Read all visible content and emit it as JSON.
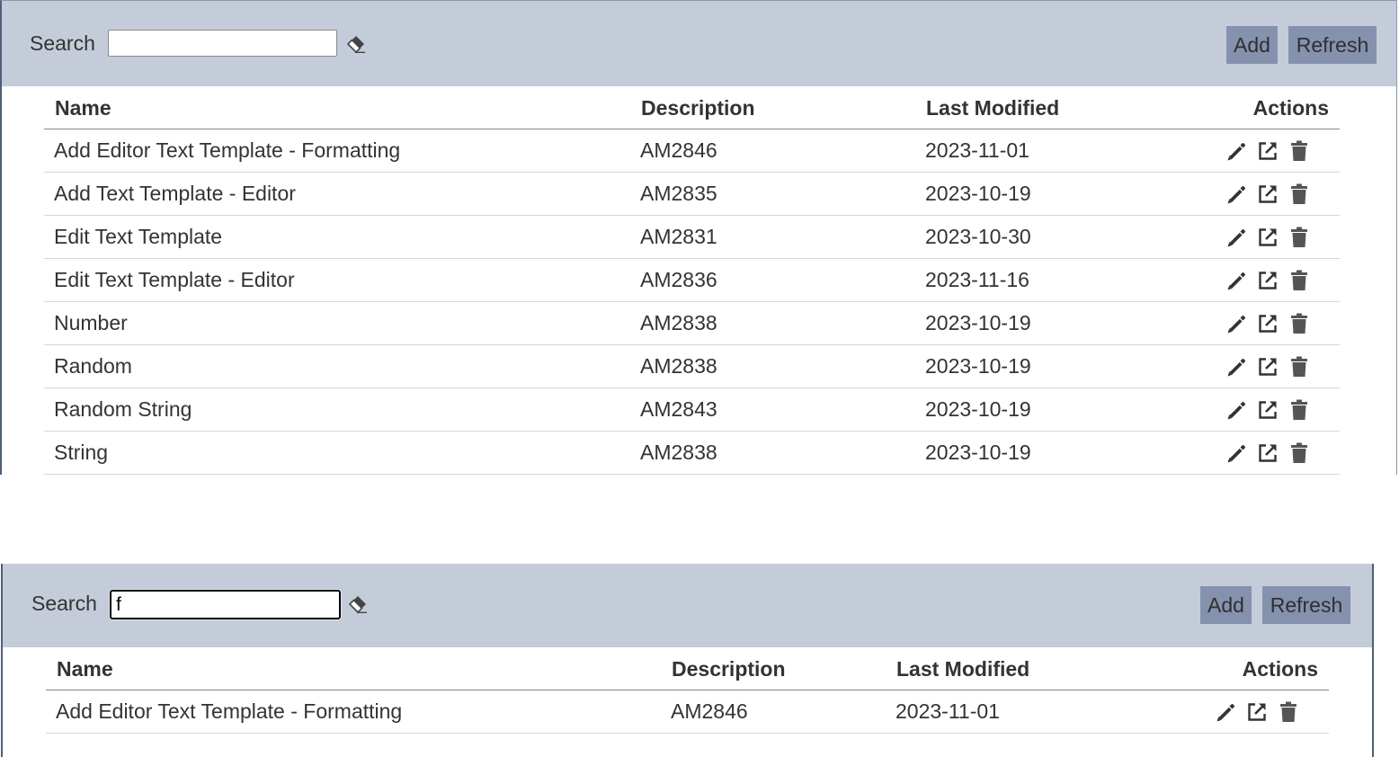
{
  "colors": {
    "toolbar_bg": "#c5ccd9",
    "button_bg": "#8592ae",
    "panel_border": "#4f5f77"
  },
  "icons": {
    "clear": "eraser-icon",
    "edit": "pencil-icon",
    "open": "external-link-icon",
    "delete": "trash-icon"
  },
  "panels": [
    {
      "search": {
        "label": "Search",
        "value": ""
      },
      "buttons": {
        "add": "Add",
        "refresh": "Refresh"
      },
      "columns": {
        "name": "Name",
        "description": "Description",
        "modified": "Last Modified",
        "actions": "Actions"
      },
      "rows": [
        {
          "name": "Add Editor Text Template - Formatting",
          "description": "AM2846",
          "modified": "2023-11-01"
        },
        {
          "name": "Add Text Template - Editor",
          "description": "AM2835",
          "modified": "2023-10-19"
        },
        {
          "name": "Edit Text Template",
          "description": "AM2831",
          "modified": "2023-10-30"
        },
        {
          "name": "Edit Text Template - Editor",
          "description": "AM2836",
          "modified": "2023-11-16"
        },
        {
          "name": "Number",
          "description": "AM2838",
          "modified": "2023-10-19"
        },
        {
          "name": "Random",
          "description": "AM2838",
          "modified": "2023-10-19"
        },
        {
          "name": "Random String",
          "description": "AM2843",
          "modified": "2023-10-19"
        },
        {
          "name": "String",
          "description": "AM2838",
          "modified": "2023-10-19"
        }
      ]
    },
    {
      "search": {
        "label": "Search",
        "value": "f"
      },
      "buttons": {
        "add": "Add",
        "refresh": "Refresh"
      },
      "columns": {
        "name": "Name",
        "description": "Description",
        "modified": "Last Modified",
        "actions": "Actions"
      },
      "rows": [
        {
          "name": "Add Editor Text Template - Formatting",
          "description": "AM2846",
          "modified": "2023-11-01"
        }
      ]
    }
  ]
}
